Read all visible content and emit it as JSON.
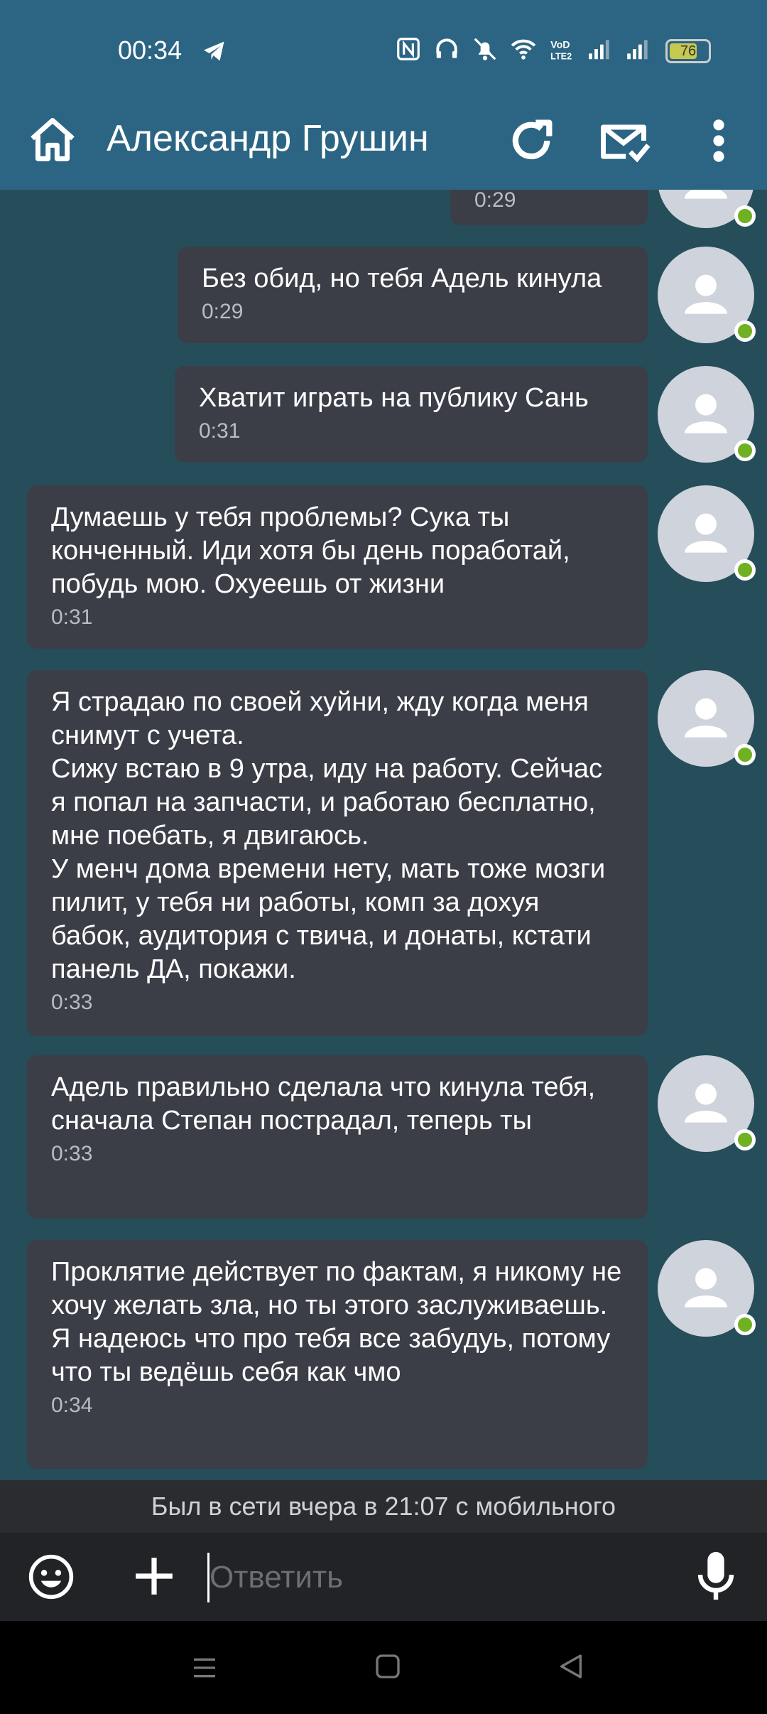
{
  "status_bar": {
    "time": "00:34",
    "battery": "76",
    "battery_level": 0.76,
    "icons": [
      "telegram-icon",
      "nfc-icon",
      "headphones-icon",
      "mute-icon",
      "wifi-icon",
      "volte-icon",
      "signal-icon",
      "signal-icon-2",
      "battery-icon"
    ]
  },
  "header": {
    "title": "Александр Грушин",
    "icons": [
      "home-icon",
      "refresh-icon",
      "mail-check-icon",
      "more-vert-icon"
    ]
  },
  "messages": [
    {
      "text": "",
      "time": "0:29"
    },
    {
      "text": "Без обид, но тебя Адель кинула",
      "time": "0:29"
    },
    {
      "text": "Хватит играть на публику Сань",
      "time": "0:31"
    },
    {
      "text": "Думаешь у тебя проблемы? Сука ты конченный. Иди хотя бы день поработай, побудь мою. Охуеешь от жизни",
      "time": "0:31"
    },
    {
      "text": "Я страдаю по своей хуйни, жду когда меня снимут с учета.\nСижу встаю в 9 утра, иду на работу. Сейчас я попал на запчасти, и работаю бесплатно, мне поебать, я двигаюсь.\nУ менч дома времени нету, мать тоже мозги пилит, у тебя ни работы, комп за дохуя бабок, аудитория с твича, и донаты, кстати панель ДА, покажи.",
      "time": "0:33"
    },
    {
      "text": "Адель правильно сделала что кинула тебя, сначала Степан пострадал, теперь ты",
      "time": "0:33"
    },
    {
      "text": "Проклятие действует по фактам, я никому не хочу желать зла, но ты этого заслуживаешь. Я надеюсь что про тебя все забудуь, потому что ты ведёшь себя как чмо",
      "time": "0:34"
    }
  ],
  "last_seen": "Был в сети вчера в 21:07 с мобильного",
  "composer": {
    "placeholder": "Ответить",
    "icons": [
      "emoji-icon",
      "plus-icon",
      "mic-icon"
    ]
  },
  "colors": {
    "header_bg": "#2b6583",
    "chat_bg": "#264d5a",
    "bubble_bg": "#3b3e47",
    "online": "#6fb122"
  }
}
